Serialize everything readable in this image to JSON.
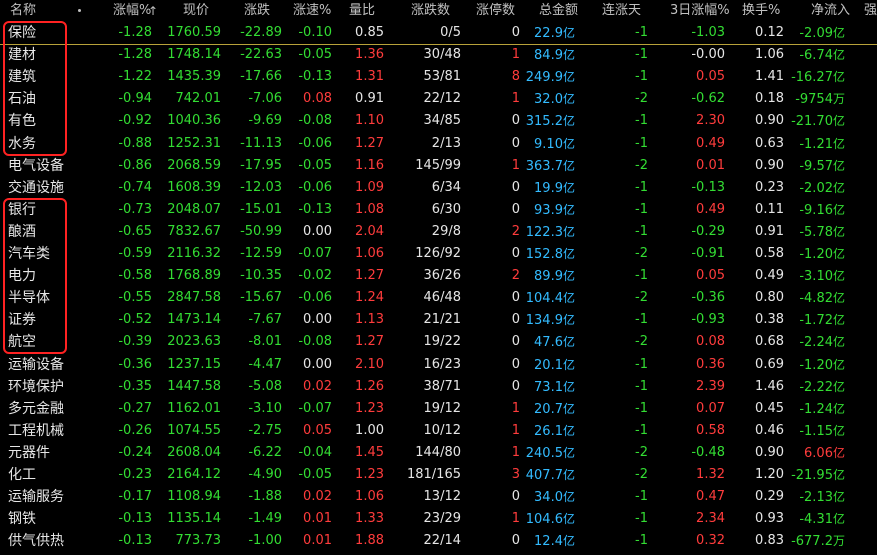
{
  "colors": {
    "green": "#33dd33",
    "red": "#ff3c3c",
    "white": "#e6e6e6",
    "yellow": "#e8e800",
    "cyan": "#33bbff",
    "header": "#c0c0c0",
    "highlight": "#ff2222"
  },
  "headers": [
    "名称",
    "涨幅%",
    "现价",
    "涨跌",
    "涨速%",
    "量比",
    "涨跌数",
    "涨停数",
    "总金额",
    "连涨天",
    "3日涨幅%",
    "换手%",
    "净流入",
    "强"
  ],
  "sort_arrow": "↑",
  "rows": [
    {
      "name": "保险",
      "chg": "-1.28",
      "price": "1760.59",
      "diff": "-22.89",
      "speed": "-0.10",
      "vr": "0.85",
      "adv": "0/5",
      "lim": "0",
      "amt": "22.9",
      "amt_u": "亿",
      "days": "-1",
      "chg3": "-1.03",
      "turn": "0.12",
      "flow": "-2.09",
      "flow_u": "亿"
    },
    {
      "name": "建材",
      "chg": "-1.28",
      "price": "1748.14",
      "diff": "-22.63",
      "speed": "-0.05",
      "vr": "1.36",
      "adv": "30/48",
      "lim": "1",
      "amt": "84.9",
      "amt_u": "亿",
      "days": "-1",
      "chg3": "-0.00",
      "turn": "1.06",
      "flow": "-6.74",
      "flow_u": "亿"
    },
    {
      "name": "建筑",
      "chg": "-1.22",
      "price": "1435.39",
      "diff": "-17.66",
      "speed": "-0.13",
      "vr": "1.31",
      "adv": "53/81",
      "lim": "8",
      "amt": "249.9",
      "amt_u": "亿",
      "days": "-1",
      "chg3": "0.05",
      "turn": "1.41",
      "flow": "-16.27",
      "flow_u": "亿"
    },
    {
      "name": "石油",
      "chg": "-0.94",
      "price": "742.01",
      "diff": "-7.06",
      "speed": "0.08",
      "vr": "0.91",
      "adv": "22/12",
      "lim": "1",
      "amt": "32.0",
      "amt_u": "亿",
      "days": "-2",
      "chg3": "-0.62",
      "turn": "0.18",
      "flow": "-9754",
      "flow_u": "万"
    },
    {
      "name": "有色",
      "chg": "-0.92",
      "price": "1040.36",
      "diff": "-9.69",
      "speed": "-0.08",
      "vr": "1.10",
      "adv": "34/85",
      "lim": "0",
      "amt": "315.2",
      "amt_u": "亿",
      "days": "-1",
      "chg3": "2.30",
      "turn": "0.90",
      "flow": "-21.70",
      "flow_u": "亿"
    },
    {
      "name": "水务",
      "chg": "-0.88",
      "price": "1252.31",
      "diff": "-11.13",
      "speed": "-0.06",
      "vr": "1.27",
      "adv": "2/13",
      "lim": "0",
      "amt": "9.10",
      "amt_u": "亿",
      "days": "-1",
      "chg3": "0.49",
      "turn": "0.63",
      "flow": "-1.21",
      "flow_u": "亿"
    },
    {
      "name": "电气设备",
      "chg": "-0.86",
      "price": "2068.59",
      "diff": "-17.95",
      "speed": "-0.05",
      "vr": "1.16",
      "adv": "145/99",
      "lim": "1",
      "amt": "363.7",
      "amt_u": "亿",
      "days": "-2",
      "chg3": "0.01",
      "turn": "0.90",
      "flow": "-9.57",
      "flow_u": "亿"
    },
    {
      "name": "交通设施",
      "chg": "-0.74",
      "price": "1608.39",
      "diff": "-12.03",
      "speed": "-0.06",
      "vr": "1.09",
      "adv": "6/34",
      "lim": "0",
      "amt": "19.9",
      "amt_u": "亿",
      "days": "-1",
      "chg3": "-0.13",
      "turn": "0.23",
      "flow": "-2.02",
      "flow_u": "亿"
    },
    {
      "name": "银行",
      "chg": "-0.73",
      "price": "2048.07",
      "diff": "-15.01",
      "speed": "-0.13",
      "vr": "1.08",
      "adv": "6/30",
      "lim": "0",
      "amt": "93.9",
      "amt_u": "亿",
      "days": "-1",
      "chg3": "0.49",
      "turn": "0.11",
      "flow": "-9.16",
      "flow_u": "亿"
    },
    {
      "name": "酿酒",
      "chg": "-0.65",
      "price": "7832.67",
      "diff": "-50.99",
      "speed": "0.00",
      "vr": "2.04",
      "adv": "29/8",
      "lim": "2",
      "amt": "122.3",
      "amt_u": "亿",
      "days": "-1",
      "chg3": "-0.29",
      "turn": "0.91",
      "flow": "-5.78",
      "flow_u": "亿"
    },
    {
      "name": "汽车类",
      "chg": "-0.59",
      "price": "2116.32",
      "diff": "-12.59",
      "speed": "-0.07",
      "vr": "1.06",
      "adv": "126/92",
      "lim": "0",
      "amt": "152.8",
      "amt_u": "亿",
      "days": "-2",
      "chg3": "-0.91",
      "turn": "0.58",
      "flow": "-1.20",
      "flow_u": "亿"
    },
    {
      "name": "电力",
      "chg": "-0.58",
      "price": "1768.89",
      "diff": "-10.35",
      "speed": "-0.02",
      "vr": "1.27",
      "adv": "36/26",
      "lim": "2",
      "amt": "89.9",
      "amt_u": "亿",
      "days": "-1",
      "chg3": "0.05",
      "turn": "0.49",
      "flow": "-3.10",
      "flow_u": "亿"
    },
    {
      "name": "半导体",
      "chg": "-0.55",
      "price": "2847.58",
      "diff": "-15.67",
      "speed": "-0.06",
      "vr": "1.24",
      "adv": "46/48",
      "lim": "0",
      "amt": "104.4",
      "amt_u": "亿",
      "days": "-2",
      "chg3": "-0.36",
      "turn": "0.80",
      "flow": "-4.82",
      "flow_u": "亿"
    },
    {
      "name": "证券",
      "chg": "-0.52",
      "price": "1473.14",
      "diff": "-7.67",
      "speed": "0.00",
      "vr": "1.13",
      "adv": "21/21",
      "lim": "0",
      "amt": "134.9",
      "amt_u": "亿",
      "days": "-1",
      "chg3": "-0.93",
      "turn": "0.38",
      "flow": "-1.72",
      "flow_u": "亿"
    },
    {
      "name": "航空",
      "chg": "-0.39",
      "price": "2023.63",
      "diff": "-8.01",
      "speed": "-0.08",
      "vr": "1.27",
      "adv": "19/22",
      "lim": "0",
      "amt": "47.6",
      "amt_u": "亿",
      "days": "-2",
      "chg3": "0.08",
      "turn": "0.68",
      "flow": "-2.24",
      "flow_u": "亿"
    },
    {
      "name": "运输设备",
      "chg": "-0.36",
      "price": "1237.15",
      "diff": "-4.47",
      "speed": "0.00",
      "vr": "2.10",
      "adv": "16/23",
      "lim": "0",
      "amt": "20.1",
      "amt_u": "亿",
      "days": "-1",
      "chg3": "0.36",
      "turn": "0.69",
      "flow": "-1.20",
      "flow_u": "亿"
    },
    {
      "name": "环境保护",
      "chg": "-0.35",
      "price": "1447.58",
      "diff": "-5.08",
      "speed": "0.02",
      "vr": "1.26",
      "adv": "38/71",
      "lim": "0",
      "amt": "73.1",
      "amt_u": "亿",
      "days": "-1",
      "chg3": "2.39",
      "turn": "1.46",
      "flow": "-2.22",
      "flow_u": "亿"
    },
    {
      "name": "多元金融",
      "chg": "-0.27",
      "price": "1162.01",
      "diff": "-3.10",
      "speed": "-0.07",
      "vr": "1.23",
      "adv": "19/12",
      "lim": "1",
      "amt": "20.7",
      "amt_u": "亿",
      "days": "-1",
      "chg3": "0.07",
      "turn": "0.45",
      "flow": "-1.24",
      "flow_u": "亿"
    },
    {
      "name": "工程机械",
      "chg": "-0.26",
      "price": "1074.55",
      "diff": "-2.75",
      "speed": "0.05",
      "vr": "1.00",
      "adv": "10/12",
      "lim": "1",
      "amt": "26.1",
      "amt_u": "亿",
      "days": "-1",
      "chg3": "0.58",
      "turn": "0.46",
      "flow": "-1.15",
      "flow_u": "亿"
    },
    {
      "name": "元器件",
      "chg": "-0.24",
      "price": "2608.04",
      "diff": "-6.22",
      "speed": "-0.04",
      "vr": "1.45",
      "adv": "144/80",
      "lim": "1",
      "amt": "240.5",
      "amt_u": "亿",
      "days": "-2",
      "chg3": "-0.48",
      "turn": "0.90",
      "flow": "6.06",
      "flow_u": "亿"
    },
    {
      "name": "化工",
      "chg": "-0.23",
      "price": "2164.12",
      "diff": "-4.90",
      "speed": "-0.05",
      "vr": "1.23",
      "adv": "181/165",
      "lim": "3",
      "amt": "407.7",
      "amt_u": "亿",
      "days": "-2",
      "chg3": "1.32",
      "turn": "1.20",
      "flow": "-21.95",
      "flow_u": "亿"
    },
    {
      "name": "运输服务",
      "chg": "-0.17",
      "price": "1108.94",
      "diff": "-1.88",
      "speed": "0.02",
      "vr": "1.06",
      "adv": "13/12",
      "lim": "0",
      "amt": "34.0",
      "amt_u": "亿",
      "days": "-1",
      "chg3": "0.47",
      "turn": "0.29",
      "flow": "-2.13",
      "flow_u": "亿"
    },
    {
      "name": "钢铁",
      "chg": "-0.13",
      "price": "1135.14",
      "diff": "-1.49",
      "speed": "0.01",
      "vr": "1.33",
      "adv": "23/29",
      "lim": "1",
      "amt": "104.6",
      "amt_u": "亿",
      "days": "-1",
      "chg3": "2.34",
      "turn": "0.93",
      "flow": "-4.31",
      "flow_u": "亿"
    },
    {
      "name": "供气供热",
      "chg": "-0.13",
      "price": "773.73",
      "diff": "-1.00",
      "speed": "0.01",
      "vr": "1.88",
      "adv": "22/14",
      "lim": "0",
      "amt": "12.4",
      "amt_u": "亿",
      "days": "-1",
      "chg3": "0.32",
      "turn": "0.83",
      "flow": "-677.2",
      "flow_u": "万"
    }
  ]
}
